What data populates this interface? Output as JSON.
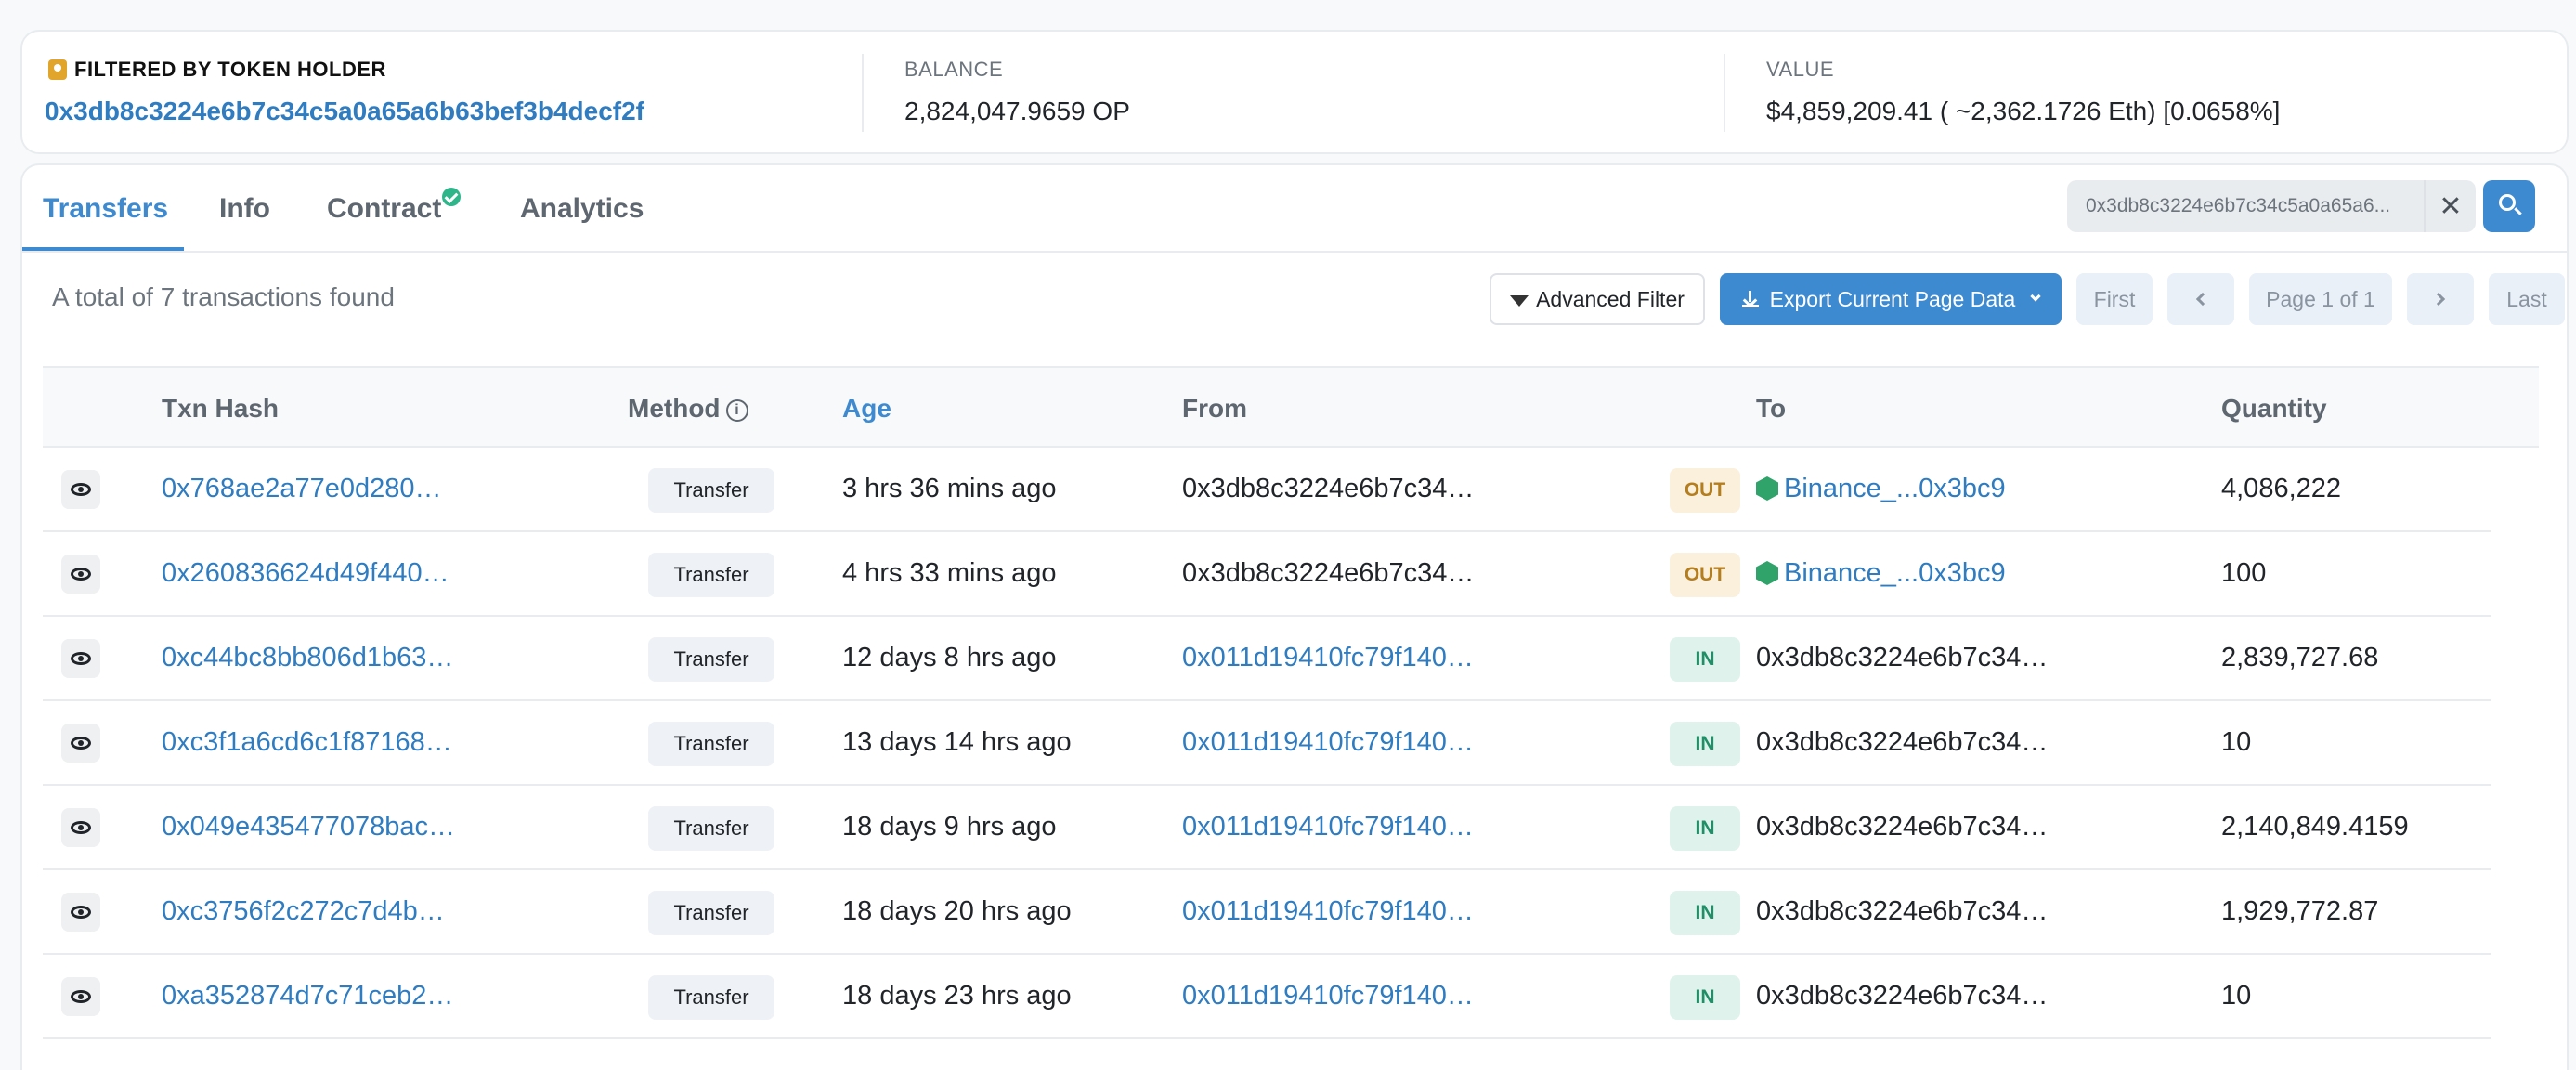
{
  "summary": {
    "holder_label": "FILTERED BY TOKEN HOLDER",
    "holder_address": "0x3db8c3224e6b7c34c5a0a65a6b63bef3b4decf2f",
    "balance_label": "BALANCE",
    "balance_value": "2,824,047.9659 OP",
    "value_label": "VALUE",
    "value_value": "$4,859,209.41 ( ~2,362.1726 Eth) [0.0658%]"
  },
  "tabs": [
    {
      "label": "Transfers",
      "active": true
    },
    {
      "label": "Info"
    },
    {
      "label": "Contract",
      "verified": true
    },
    {
      "label": "Analytics"
    }
  ],
  "search": {
    "value": "0x3db8c3224e6b7c34c5a0a65a6..."
  },
  "toolbar": {
    "total_text": "A total of 7 transactions found",
    "advanced_filter": "Advanced Filter",
    "export": "Export Current Page Data",
    "first": "First",
    "page_info": "Page 1 of 1",
    "last": "Last"
  },
  "columns": {
    "txn_hash": "Txn Hash",
    "method": "Method",
    "age": "Age",
    "from": "From",
    "to": "To",
    "quantity": "Quantity"
  },
  "rows": [
    {
      "hash": "0x768ae2a77e0d280…",
      "method": "Transfer",
      "age": "3 hrs 36 mins ago",
      "from": "0x3db8c3224e6b7c34…",
      "from_link": false,
      "dir": "OUT",
      "to": "Binance_...0x3bc9",
      "to_link": true,
      "quantity": "4,086,222"
    },
    {
      "hash": "0x260836624d49f440…",
      "method": "Transfer",
      "age": "4 hrs 33 mins ago",
      "from": "0x3db8c3224e6b7c34…",
      "from_link": false,
      "dir": "OUT",
      "to": "Binance_...0x3bc9",
      "to_link": true,
      "quantity": "100"
    },
    {
      "hash": "0xc44bc8bb806d1b63…",
      "method": "Transfer",
      "age": "12 days 8 hrs ago",
      "from": "0x011d19410fc79f140…",
      "from_link": true,
      "dir": "IN",
      "to": "0x3db8c3224e6b7c34…",
      "to_link": false,
      "quantity": "2,839,727.68"
    },
    {
      "hash": "0xc3f1a6cd6c1f87168…",
      "method": "Transfer",
      "age": "13 days 14 hrs ago",
      "from": "0x011d19410fc79f140…",
      "from_link": true,
      "dir": "IN",
      "to": "0x3db8c3224e6b7c34…",
      "to_link": false,
      "quantity": "10"
    },
    {
      "hash": "0x049e435477078bac…",
      "method": "Transfer",
      "age": "18 days 9 hrs ago",
      "from": "0x011d19410fc79f140…",
      "from_link": true,
      "dir": "IN",
      "to": "0x3db8c3224e6b7c34…",
      "to_link": false,
      "quantity": "2,140,849.4159"
    },
    {
      "hash": "0xc3756f2c272c7d4b…",
      "method": "Transfer",
      "age": "18 days 20 hrs ago",
      "from": "0x011d19410fc79f140…",
      "from_link": true,
      "dir": "IN",
      "to": "0x3db8c3224e6b7c34…",
      "to_link": false,
      "quantity": "1,929,772.87"
    },
    {
      "hash": "0xa352874d7c71ceb2…",
      "method": "Transfer",
      "age": "18 days 23 hrs ago",
      "from": "0x011d19410fc79f140…",
      "from_link": true,
      "dir": "IN",
      "to": "0x3db8c3224e6b7c34…",
      "to_link": false,
      "quantity": "10"
    }
  ],
  "colors": {
    "accent": "#3d8ad0",
    "link": "#2f7cc1",
    "out_badge": "#fbf0dc",
    "in_badge": "#dff3ec"
  }
}
